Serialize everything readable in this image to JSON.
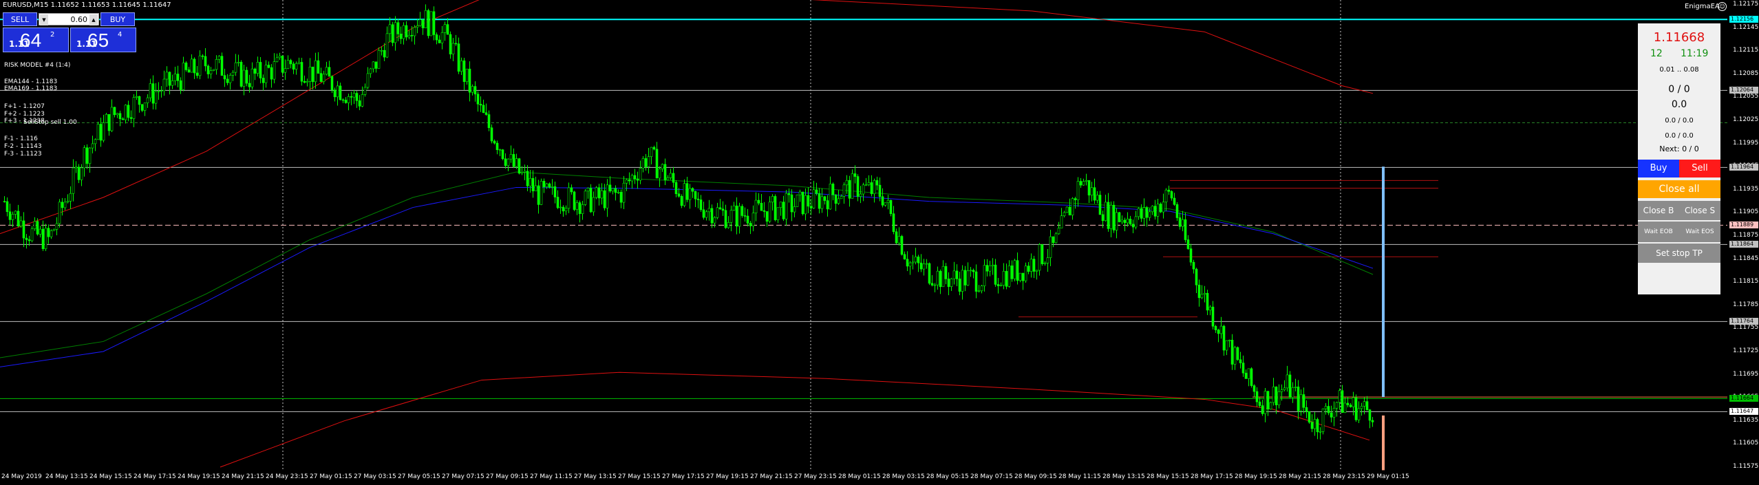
{
  "header": {
    "symbol_line": "EURUSD,M15  1.11652 1.11653 1.11645 1.11647",
    "ea_name": "EnigmaEA",
    "ea_icon": "smiley-icon"
  },
  "one_click": {
    "sell_label": "SELL",
    "buy_label": "BUY",
    "volume": "0.60",
    "down_icon": "▼",
    "up_icon": "▲",
    "bid": {
      "small": "1.11",
      "big": "64",
      "sup": "2"
    },
    "ask": {
      "small": "1.11",
      "big": "65",
      "sup": "4"
    }
  },
  "indicators": {
    "risk_model": "RISK MODEL #4 (1:4)",
    "ema144": "EMA144 - 1.1183",
    "ema169": "EMA169 - 1.1183",
    "f_plus_1": "F+1 - 1.1207",
    "f_plus_2": "F+2 - 1.1223",
    "f_plus_3": "F+3 - 1.1238",
    "sell_tag": "SellStop sell 1.00",
    "f_minus_1": "F-1 - 1.116",
    "f_minus_2": "F-2 - 1.1143",
    "f_minus_3": "F-3 - 1.1123"
  },
  "panel": {
    "price": "1.11668",
    "spread": "12",
    "time": "11:19",
    "lots": "0.01 .. 0.08",
    "count": "0 / 0",
    "profit": "0.0",
    "row1": "0.0 / 0.0",
    "row2": "0.0 / 0.0",
    "next": "Next: 0 / 0",
    "buy": "Buy",
    "sell": "Sell",
    "close_all": "Close all",
    "close_b": "Close B",
    "close_s": "Close S",
    "wait_eob": "Wait EOB",
    "wait_eos": "Wait EOS",
    "set_stop_tp": "Set stop TP"
  },
  "price_axis": {
    "labels": [
      "1.12175",
      "1.12145",
      "1.12115",
      "1.12085",
      "1.12055",
      "1.12025",
      "1.11995",
      "1.11965",
      "1.11935",
      "1.11905",
      "1.11875",
      "1.11845",
      "1.11815",
      "1.11785",
      "1.11755",
      "1.11725",
      "1.11695",
      "1.11665",
      "1.11635",
      "1.11605",
      "1.11575"
    ],
    "tags": [
      {
        "text": "1.12156",
        "color": "#00ffff",
        "price": 1.12156
      },
      {
        "text": "1.12064",
        "color": "#c0c0c0",
        "price": 1.12064
      },
      {
        "text": "1.11964",
        "color": "#c0c0c0",
        "price": 1.11964
      },
      {
        "text": "1.11889",
        "color": "#ffc0c0",
        "price": 1.11889
      },
      {
        "text": "1.11864",
        "color": "#c0c0c0",
        "price": 1.11864
      },
      {
        "text": "1.11764",
        "color": "#c0c0c0",
        "price": 1.11764
      },
      {
        "text": "1.11664",
        "color": "#00c000",
        "price": 1.11664
      },
      {
        "text": "1.11647",
        "color": "#ffffff",
        "price": 1.11647
      }
    ]
  },
  "time_axis": {
    "labels": [
      "24 May 2019",
      "24 May 13:15",
      "24 May 15:15",
      "24 May 17:15",
      "24 May 19:15",
      "24 May 21:15",
      "24 May 23:15",
      "27 May 01:15",
      "27 May 03:15",
      "27 May 05:15",
      "27 May 07:15",
      "27 May 09:15",
      "27 May 11:15",
      "27 May 13:15",
      "27 May 15:15",
      "27 May 17:15",
      "27 May 19:15",
      "27 May 21:15",
      "27 May 23:15",
      "28 May 01:15",
      "28 May 03:15",
      "28 May 05:15",
      "28 May 07:15",
      "28 May 09:15",
      "28 May 11:15",
      "28 May 13:15",
      "28 May 15:15",
      "28 May 17:15",
      "28 May 19:15",
      "28 May 21:15",
      "28 May 23:15",
      "29 May 01:15"
    ]
  },
  "colors": {
    "background": "#000000",
    "candle": "#00ff00",
    "ema144": "#008000",
    "ema169": "#1a1aff",
    "envelope": "#e01010",
    "resistance": "#00ffff",
    "level": "#c0c0c0",
    "bid_line": "#00c000",
    "ask_line": "#ffffff",
    "sell_line": "#ff8040",
    "bar_up": "#80c0ff",
    "bar_down": "#ffa080"
  }
}
